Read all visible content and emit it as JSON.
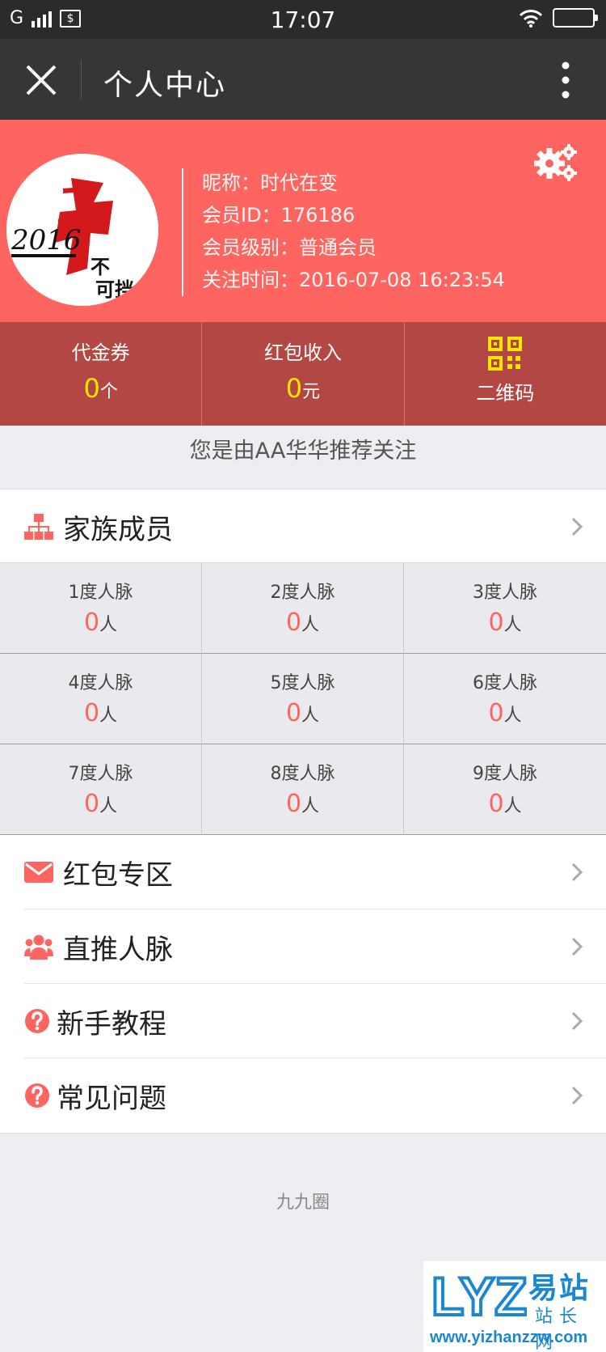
{
  "status_bar": {
    "carrier": "G",
    "time": "17:07"
  },
  "nav": {
    "title": "个人中心"
  },
  "profile": {
    "nickname_line": "昵称：时代在变",
    "member_id_line": "会员ID：176186",
    "level_line": "会员级别：普通会员",
    "follow_time_line": "关注时间：2016-07-08 16:23:54"
  },
  "stats": {
    "voucher": {
      "label": "代金券",
      "value": "0",
      "unit": "个"
    },
    "redpack": {
      "label": "红包收入",
      "value": "0",
      "unit": "元"
    },
    "qrcode": {
      "label": "二维码"
    }
  },
  "referral_text": "您是由AA华华推荐关注",
  "family": {
    "title": "家族成员",
    "degrees": [
      {
        "label": "1度人脉",
        "value": "0",
        "unit": "人"
      },
      {
        "label": "2度人脉",
        "value": "0",
        "unit": "人"
      },
      {
        "label": "3度人脉",
        "value": "0",
        "unit": "人"
      },
      {
        "label": "4度人脉",
        "value": "0",
        "unit": "人"
      },
      {
        "label": "5度人脉",
        "value": "0",
        "unit": "人"
      },
      {
        "label": "6度人脉",
        "value": "0",
        "unit": "人"
      },
      {
        "label": "7度人脉",
        "value": "0",
        "unit": "人"
      },
      {
        "label": "8度人脉",
        "value": "0",
        "unit": "人"
      },
      {
        "label": "9度人脉",
        "value": "0",
        "unit": "人"
      }
    ]
  },
  "menu": {
    "items": [
      {
        "label": "红包专区",
        "icon": "envelope-icon"
      },
      {
        "label": "直推人脉",
        "icon": "users-icon"
      },
      {
        "label": "新手教程",
        "icon": "question-icon"
      },
      {
        "label": "常见问题",
        "icon": "question-icon"
      }
    ]
  },
  "footer": "九九圈",
  "watermark": {
    "logo_text": "LYZ",
    "cn_name": "易站",
    "cn_sub": "站长网",
    "url": "www.yizhanzzw.com"
  },
  "colors": {
    "brand": "#fe6561",
    "stats_bg": "#b34744",
    "highlight": "#ffe600",
    "nav_bg": "#363636",
    "watermark": "#1b86d1"
  }
}
